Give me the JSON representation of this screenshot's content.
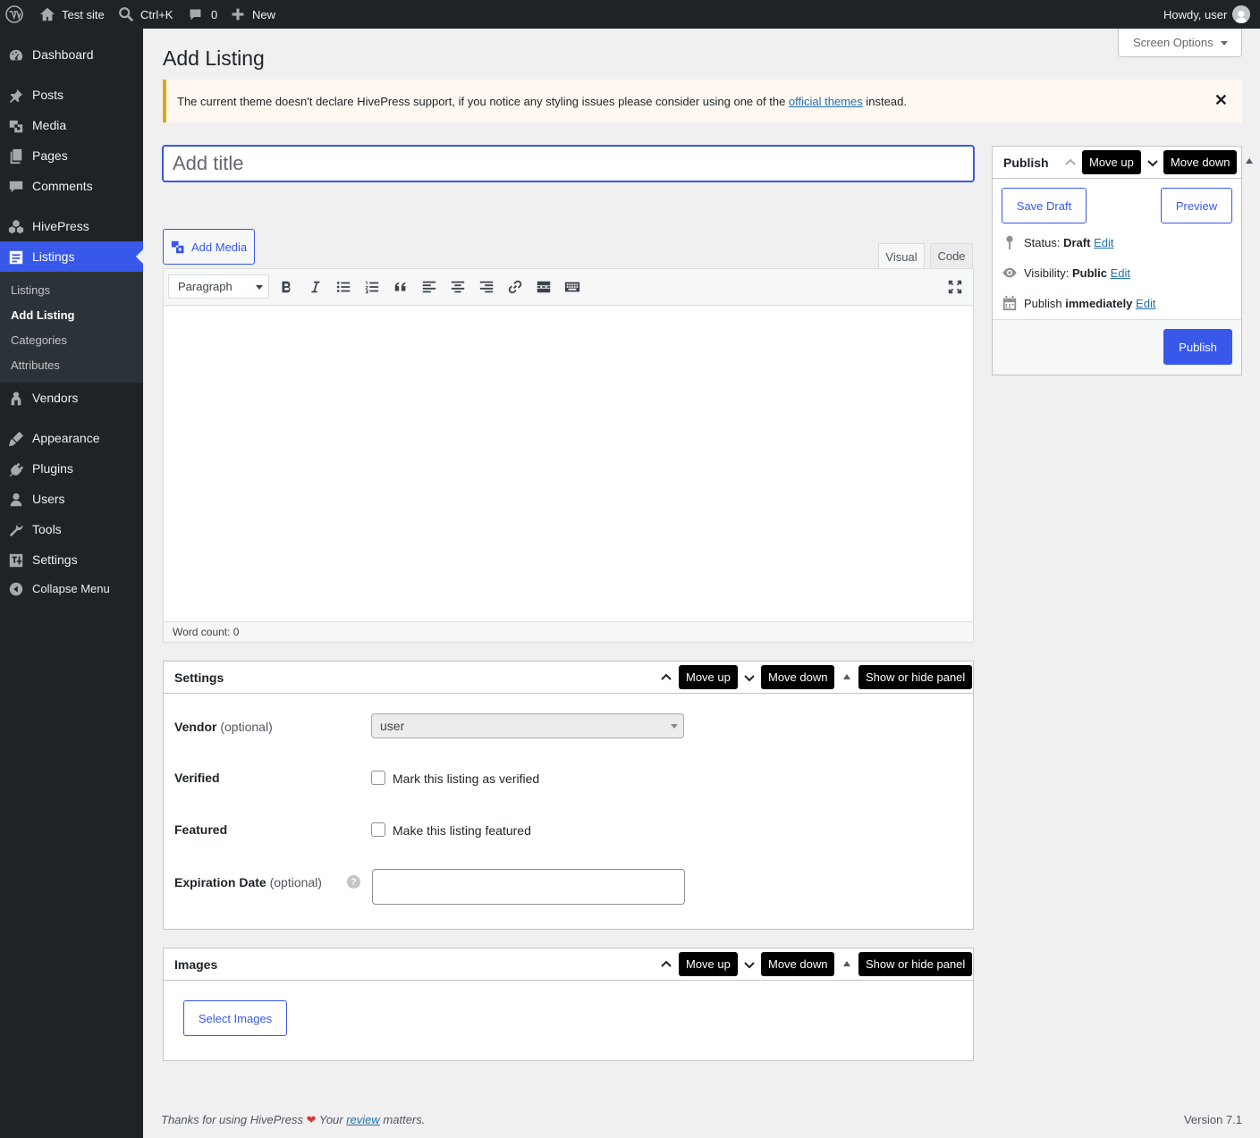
{
  "adminbar": {
    "site_name": "Test site",
    "search_shortcut": "Ctrl+K",
    "comments_count": "0",
    "new_label": "New",
    "howdy": "Howdy, user"
  },
  "sidebar": {
    "items": [
      {
        "label": "Dashboard",
        "icon": "dashboard-icon"
      },
      {
        "label": "Posts",
        "icon": "pin-icon"
      },
      {
        "label": "Media",
        "icon": "media-icon"
      },
      {
        "label": "Pages",
        "icon": "pages-icon"
      },
      {
        "label": "Comments",
        "icon": "comment-icon"
      },
      {
        "label": "HivePress",
        "icon": "hivepress-icon"
      },
      {
        "label": "Listings",
        "icon": "listings-icon"
      },
      {
        "label": "Vendors",
        "icon": "vendors-icon"
      },
      {
        "label": "Appearance",
        "icon": "brush-icon"
      },
      {
        "label": "Plugins",
        "icon": "plugin-icon"
      },
      {
        "label": "Users",
        "icon": "users-icon"
      },
      {
        "label": "Tools",
        "icon": "wrench-icon"
      },
      {
        "label": "Settings",
        "icon": "settings-icon"
      },
      {
        "label": "Collapse Menu",
        "icon": "collapse-icon"
      }
    ],
    "submenu": [
      "Listings",
      "Add Listing",
      "Categories",
      "Attributes"
    ]
  },
  "screen_options": "Screen Options",
  "page_title": "Add Listing",
  "notice": {
    "text_before": "The current theme doesn't declare HivePress support, if you notice any styling issues please consider using one of the ",
    "link": "official themes",
    "text_after": " instead."
  },
  "title_placeholder": "Add title",
  "editor": {
    "add_media": "Add Media",
    "tab_visual": "Visual",
    "tab_code": "Code",
    "format": "Paragraph",
    "word_count": "Word count: 0"
  },
  "tooltips": {
    "move_up": "Move up",
    "move_down": "Move down",
    "toggle": "Show or hide panel"
  },
  "publish": {
    "title": "Publish",
    "save_draft": "Save Draft",
    "preview": "Preview",
    "status_label": "Status: ",
    "status_value": "Draft",
    "visibility_label": "Visibility: ",
    "visibility_value": "Public",
    "publish_label": "Publish ",
    "publish_value": "immediately",
    "edit": "Edit",
    "publish_button": "Publish"
  },
  "settings": {
    "title": "Settings",
    "vendor_label": "Vendor",
    "optional": "(optional)",
    "vendor_value": "user",
    "verified_label": "Verified",
    "verified_text": "Mark this listing as verified",
    "featured_label": "Featured",
    "featured_text": "Make this listing featured",
    "expiration_label": "Expiration Date"
  },
  "images": {
    "title": "Images",
    "select": "Select Images"
  },
  "footer": {
    "thanks": "Thanks for using HivePress ",
    "your": " Your ",
    "review": "review",
    "matters": " matters.",
    "version": "Version 7.1"
  }
}
